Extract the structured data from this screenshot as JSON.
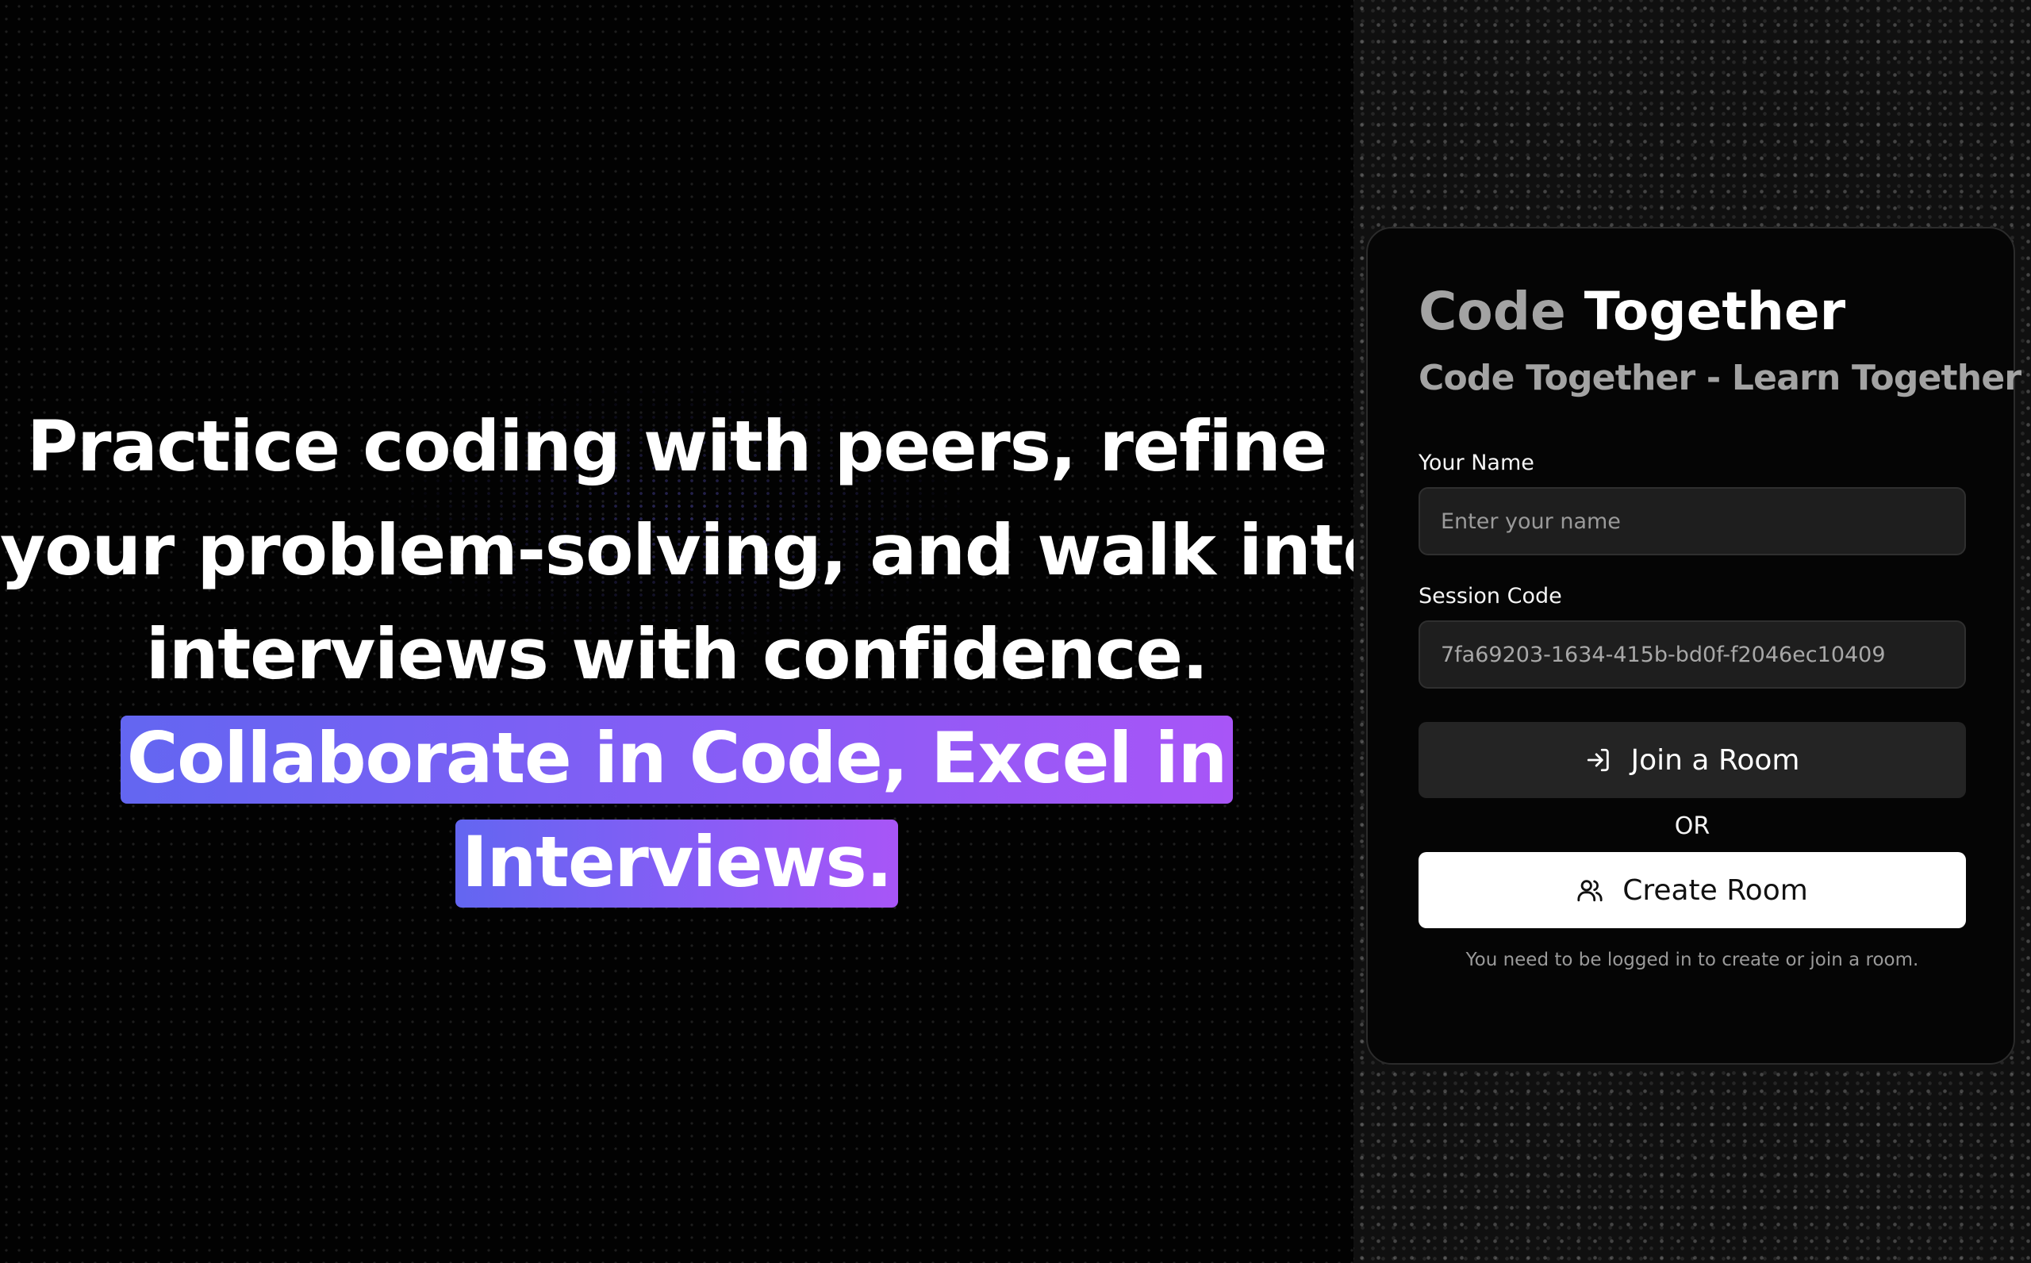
{
  "hero": {
    "lines": [
      "Practice coding with peers, refine",
      "your problem-solving, and walk into",
      "interviews with confidence."
    ],
    "highlight_lines": [
      "Collaborate in Code, Excel in",
      "Interviews."
    ]
  },
  "card": {
    "title_part1": "Code",
    "title_part2": "Together",
    "subtitle": "Code Together - Learn Together",
    "name_label": "Your Name",
    "name_placeholder": "Enter your name",
    "code_label": "Session Code",
    "code_value": "7fa69203-1634-415b-bd0f-f2046ec10409",
    "join_button": "Join a Room",
    "or_text": "OR",
    "create_button": "Create Room",
    "note": "You need to be logged in to create or join a room."
  },
  "icons": {
    "join": "login-icon",
    "create": "users-icon"
  },
  "colors": {
    "highlight_start": "#6366f1",
    "highlight_end": "#a855f7",
    "card_bg": "#050505",
    "input_bg": "#1e1e1e",
    "join_button_bg": "#242424",
    "create_button_bg": "#ffffff"
  }
}
